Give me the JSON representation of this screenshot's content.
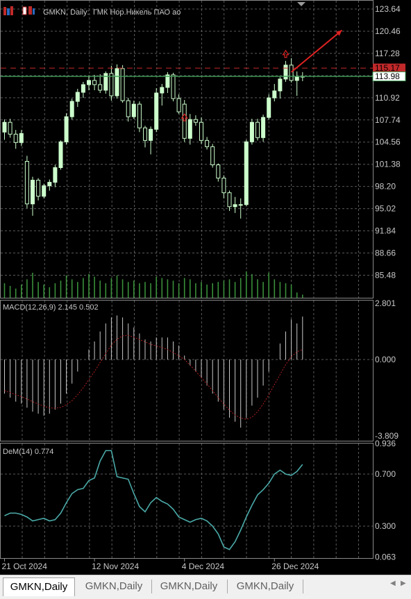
{
  "header": {
    "symbol_text": "GMKN, Daily:",
    "name_text": "ГМК Нор.Никель ПАО ао"
  },
  "colors": {
    "background": "#000000",
    "grid": "#5a5a5a",
    "bull_candle": "#ccffcc",
    "bear_candle": "#000000",
    "candle_outline": "#ccffcc",
    "volume": "#3a8f3a",
    "bid_line": "#41a05a",
    "ask_line": "#c8282a",
    "macd_hist": "#c8c8c8",
    "macd_signal": "#b02020",
    "dem_line": "#4aaaa8",
    "arrow": "#dd2222",
    "axis_text": "#c8c8c8"
  },
  "chart_data": [
    {
      "type": "candlestick",
      "title": "GMKN, Daily: ГМК Нор.Никель ПАО ао",
      "ylim": [
        82.3,
        124.4
      ],
      "y_ticks": [
        123.64,
        120.46,
        117.28,
        114.1,
        110.92,
        107.74,
        104.56,
        101.38,
        98.2,
        95.02,
        91.84,
        88.66,
        85.48
      ],
      "y_tick_labels": [
        "123.64",
        "120.46",
        "117.28",
        "",
        "110.92",
        "107.74",
        "104.56",
        "101.38",
        "98.20",
        "95.02",
        "91.84",
        "88.66",
        "85.48"
      ],
      "x_labels": [
        {
          "bar": 0,
          "label": "21 Oct 2024"
        },
        {
          "bar": 16,
          "label": "12 Nov 2024"
        },
        {
          "bar": 32,
          "label": "4 Dec 2024"
        },
        {
          "bar": 48,
          "label": "26 Dec 2024"
        }
      ],
      "price_labels": {
        "ask": "115.17",
        "bid": "113.98"
      },
      "ask_price": 115.17,
      "bid_price": 113.98,
      "ohlc": [
        [
          106.0,
          107.8,
          104.9,
          107.4
        ],
        [
          107.4,
          107.9,
          105.2,
          105.7
        ],
        [
          105.7,
          106.3,
          103.6,
          104.5
        ],
        [
          104.5,
          106.3,
          104.0,
          105.8
        ],
        [
          101.8,
          102.6,
          95.1,
          95.7
        ],
        [
          95.7,
          99.6,
          94.0,
          99.1
        ],
        [
          99.1,
          99.4,
          96.2,
          96.8
        ],
        [
          96.8,
          98.6,
          96.5,
          98.3
        ],
        [
          98.3,
          99.2,
          97.6,
          98.8
        ],
        [
          98.8,
          101.3,
          98.1,
          100.9
        ],
        [
          100.9,
          104.8,
          100.6,
          104.6
        ],
        [
          104.6,
          108.7,
          104.2,
          108.2
        ],
        [
          108.2,
          110.8,
          107.8,
          110.4
        ],
        [
          110.4,
          112.2,
          109.6,
          111.7
        ],
        [
          111.7,
          113.2,
          110.9,
          112.8
        ],
        [
          112.8,
          114.1,
          112.0,
          113.4
        ],
        [
          113.4,
          114.2,
          112.0,
          112.8
        ],
        [
          112.8,
          114.3,
          111.6,
          112.0
        ],
        [
          112.0,
          114.7,
          111.5,
          114.4
        ],
        [
          114.4,
          115.5,
          110.5,
          111.2
        ],
        [
          111.2,
          115.7,
          110.8,
          115.1
        ],
        [
          115.1,
          115.6,
          110.2,
          110.5
        ],
        [
          110.5,
          110.9,
          107.5,
          108.2
        ],
        [
          108.2,
          110.5,
          107.9,
          110.0
        ],
        [
          110.0,
          110.4,
          106.0,
          106.6
        ],
        [
          106.6,
          106.9,
          103.8,
          104.8
        ],
        [
          104.8,
          106.8,
          102.8,
          106.4
        ],
        [
          106.4,
          112.3,
          106.0,
          111.6
        ],
        [
          111.6,
          112.9,
          109.8,
          112.4
        ],
        [
          112.4,
          114.6,
          111.6,
          114.2
        ],
        [
          114.2,
          114.5,
          110.4,
          110.8
        ],
        [
          110.8,
          111.4,
          108.6,
          108.9
        ],
        [
          110.0,
          110.6,
          104.6,
          105.1
        ],
        [
          105.1,
          108.6,
          104.2,
          107.8
        ],
        [
          107.8,
          108.4,
          106.9,
          107.4
        ],
        [
          107.4,
          108.1,
          104.3,
          104.8
        ],
        [
          104.8,
          105.3,
          103.5,
          103.9
        ],
        [
          103.9,
          104.3,
          100.9,
          101.3
        ],
        [
          101.3,
          101.5,
          98.9,
          99.4
        ],
        [
          99.4,
          99.8,
          96.5,
          97.3
        ],
        [
          97.3,
          97.6,
          94.7,
          95.3
        ],
        [
          95.3,
          96.7,
          94.4,
          95.6
        ],
        [
          95.6,
          96.5,
          93.6,
          95.6
        ],
        [
          95.6,
          104.9,
          95.4,
          104.6
        ],
        [
          104.6,
          107.9,
          104.2,
          107.4
        ],
        [
          107.4,
          107.9,
          104.8,
          105.2
        ],
        [
          105.2,
          108.5,
          104.6,
          108.1
        ],
        [
          108.1,
          111.4,
          107.8,
          110.9
        ],
        [
          110.9,
          112.9,
          110.4,
          111.9
        ],
        [
          111.9,
          113.9,
          110.8,
          113.6
        ],
        [
          113.6,
          116.2,
          113.2,
          115.6
        ],
        [
          115.6,
          116.6,
          113.1,
          113.4
        ],
        [
          113.4,
          114.7,
          111.2,
          113.9
        ],
        [
          113.9,
          114.6,
          113.3,
          113.98
        ]
      ],
      "marks": [
        {
          "bar": 32,
          "price": 108.0,
          "kind": "up-arrow"
        },
        {
          "bar": 50,
          "price": 117.1,
          "kind": "up-arrow"
        }
      ],
      "trend_arrow": {
        "from_bar": 51,
        "from_price": 114.6,
        "to_bar": 60,
        "to_price": 120.6
      },
      "volume": [
        0.55,
        0.45,
        0.35,
        0.5,
        0.7,
        0.95,
        0.6,
        0.5,
        0.4,
        0.55,
        0.65,
        0.85,
        0.7,
        0.6,
        0.75,
        0.9,
        0.8,
        0.65,
        0.55,
        0.75,
        0.85,
        0.7,
        0.6,
        0.65,
        0.55,
        0.6,
        0.55,
        0.8,
        0.75,
        0.7,
        0.65,
        0.55,
        0.75,
        0.7,
        0.55,
        0.6,
        0.5,
        0.55,
        0.6,
        0.65,
        0.7,
        0.6,
        0.75,
        1.0,
        0.9,
        0.7,
        0.6,
        0.95,
        0.7,
        0.6,
        0.55,
        0.5,
        0.2,
        0.12
      ]
    },
    {
      "type": "histogram+line",
      "title": "MACD(12,26,9) 2.145 0.502",
      "ylim": [
        -3.809,
        2.801
      ],
      "y_tick_labels": [
        "2.801",
        "0.000",
        "-3.809"
      ],
      "histogram": [
        -1.7,
        -1.9,
        -2.1,
        -2.2,
        -2.4,
        -2.6,
        -2.7,
        -2.8,
        -2.7,
        -2.5,
        -2.2,
        -1.7,
        -1.2,
        -0.6,
        0.0,
        0.5,
        0.9,
        1.4,
        1.8,
        2.1,
        2.2,
        2.1,
        1.8,
        1.6,
        1.3,
        1.0,
        0.9,
        1.1,
        1.1,
        1.1,
        0.9,
        0.7,
        0.2,
        -0.3,
        -0.6,
        -0.9,
        -1.3,
        -1.7,
        -2.1,
        -2.5,
        -2.9,
        -3.1,
        -3.4,
        -2.9,
        -2.3,
        -1.9,
        -1.3,
        -0.6,
        0.0,
        0.8,
        1.4,
        2.0,
        1.8,
        2.145
      ],
      "signal": [
        -1.55,
        -1.65,
        -1.75,
        -1.85,
        -1.97,
        -2.1,
        -2.22,
        -2.33,
        -2.41,
        -2.43,
        -2.39,
        -2.25,
        -2.05,
        -1.76,
        -1.4,
        -1.0,
        -0.6,
        -0.15,
        0.3,
        0.72,
        1.02,
        1.18,
        1.2,
        1.12,
        1.0,
        0.88,
        0.76,
        0.68,
        0.6,
        0.5,
        0.35,
        0.18,
        0.0,
        -0.28,
        -0.58,
        -0.9,
        -1.22,
        -1.55,
        -1.9,
        -2.22,
        -2.52,
        -2.77,
        -2.92,
        -2.98,
        -2.88,
        -2.6,
        -2.22,
        -1.76,
        -1.25,
        -0.75,
        -0.25,
        0.15,
        0.38,
        0.502
      ]
    },
    {
      "type": "line",
      "title": "DeM(14) 0.774",
      "ylim": [
        0.063,
        0.936
      ],
      "y_tick_labels": [
        "0.936",
        "0.700",
        "0.300",
        "0.063"
      ],
      "values": [
        0.38,
        0.4,
        0.4,
        0.39,
        0.37,
        0.34,
        0.35,
        0.36,
        0.34,
        0.35,
        0.4,
        0.48,
        0.55,
        0.58,
        0.59,
        0.65,
        0.67,
        0.8,
        0.88,
        0.88,
        0.68,
        0.67,
        0.66,
        0.55,
        0.45,
        0.41,
        0.48,
        0.52,
        0.49,
        0.47,
        0.43,
        0.37,
        0.35,
        0.33,
        0.35,
        0.36,
        0.34,
        0.3,
        0.24,
        0.14,
        0.12,
        0.18,
        0.27,
        0.37,
        0.46,
        0.54,
        0.58,
        0.63,
        0.7,
        0.73,
        0.7,
        0.69,
        0.72,
        0.774
      ]
    }
  ],
  "tabs": [
    "GMKN,Daily",
    "GMKN,Daily",
    "GMKN,Daily",
    "GMKN,Daily"
  ],
  "nav": {
    "left": "◀",
    "right": "▶"
  }
}
